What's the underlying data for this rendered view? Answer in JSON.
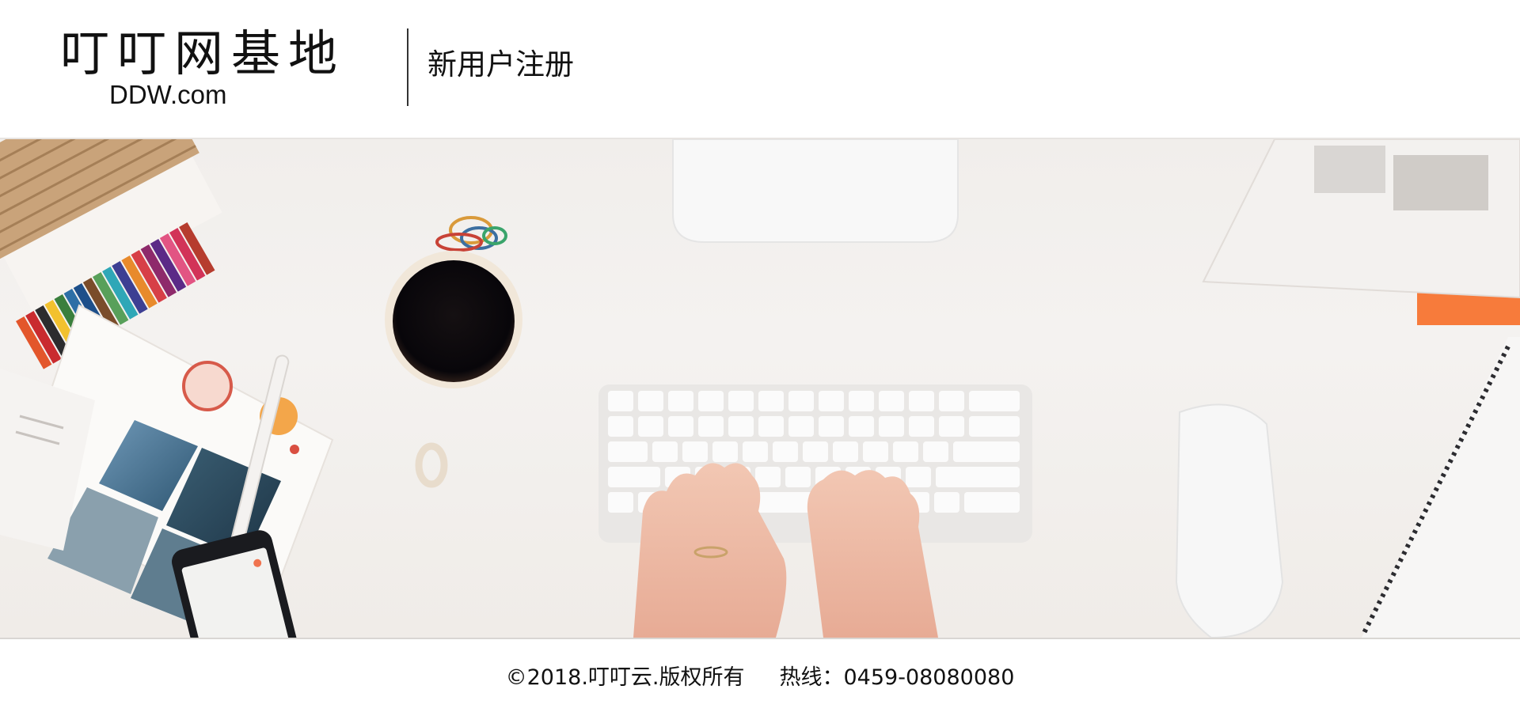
{
  "header": {
    "logo_text": "叮叮网基地",
    "logo_domain": "DDW.com",
    "subtitle": "新用户注册"
  },
  "banner": {
    "image_subject": "desk-workspace-photo"
  },
  "footer": {
    "copyright": "©2018.叮叮云.版权所有",
    "hotline_label": "热线：",
    "hotline_number": "0459-08080080"
  }
}
